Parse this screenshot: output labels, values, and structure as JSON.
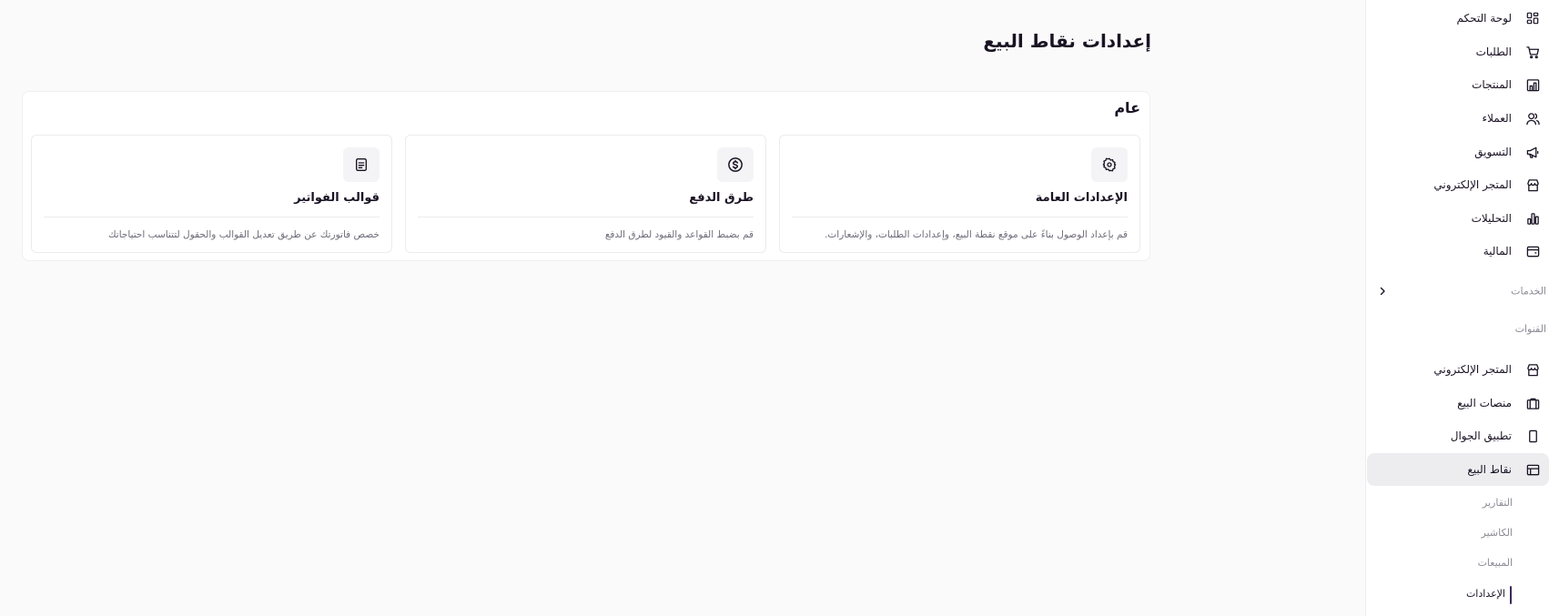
{
  "page": {
    "title": "إعدادات نقاط البيع"
  },
  "section": {
    "title": "عام"
  },
  "cards": [
    {
      "title": "الإعدادات العامة",
      "description": "قم بإعداد الوصول بناءً على موقع نقطة البيع، وإعدادات الطلبات، والإشعارات.",
      "icon": "gear-icon"
    },
    {
      "title": "طرق الدفع",
      "description": "قم بضبط القواعد والقيود لطرق الدفع",
      "icon": "dollar-circle-icon"
    },
    {
      "title": "قوالب الفواتير",
      "description": "خصص فاتورتك عن طريق تعديل القوالب والحقول لتتناسب احتياجاتك",
      "icon": "document-icon"
    }
  ],
  "sidebar": {
    "main_items": [
      {
        "label": "لوحة التحكم",
        "icon": "dashboard-grid-icon"
      },
      {
        "label": "الطلبات",
        "icon": "cart-icon"
      },
      {
        "label": "المنتجات",
        "icon": "products-icon"
      },
      {
        "label": "العملاء",
        "icon": "users-icon"
      },
      {
        "label": "التسويق",
        "icon": "megaphone-icon"
      },
      {
        "label": "المتجر الإلكتروني",
        "icon": "store-icon"
      },
      {
        "label": "التحليلات",
        "icon": "bar-chart-icon"
      },
      {
        "label": "المالية",
        "icon": "wallet-icon"
      }
    ],
    "services_label": "الخدمات",
    "channels_label": "القنوات",
    "channel_items": [
      {
        "label": "المتجر الإلكتروني",
        "icon": "store-icon"
      },
      {
        "label": "منصات البيع",
        "icon": "briefcase-icon"
      },
      {
        "label": "تطبيق الجوال",
        "icon": "mobile-icon"
      },
      {
        "label": "نقاط البيع",
        "icon": "pos-icon",
        "active": true
      }
    ],
    "pos_sub_items": [
      {
        "label": "التقارير"
      },
      {
        "label": "الكاشير"
      },
      {
        "label": "المبيعات"
      },
      {
        "label": "الإعدادات",
        "active": true
      }
    ]
  },
  "colors": {
    "accent": "#3c2a5a",
    "text": "#1a1324",
    "muted": "#8e8b96",
    "active_bg": "#ededf0"
  }
}
